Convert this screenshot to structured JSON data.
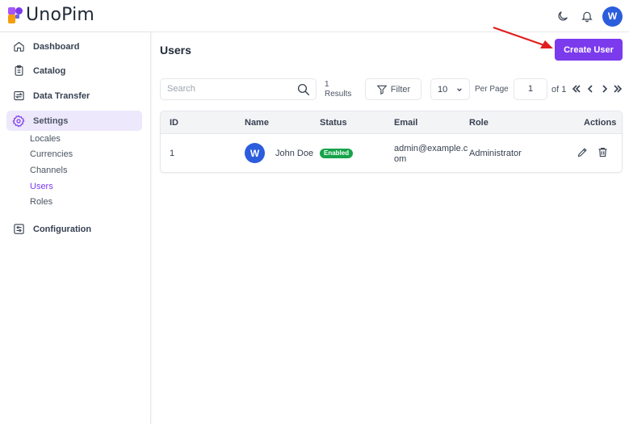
{
  "header": {
    "brand": "UnoPim",
    "avatar_letter": "W"
  },
  "sidebar": {
    "items": [
      {
        "label": "Dashboard"
      },
      {
        "label": "Catalog"
      },
      {
        "label": "Data Transfer"
      },
      {
        "label": "Settings"
      },
      {
        "label": "Configuration"
      }
    ],
    "settings_children": [
      {
        "label": "Locales"
      },
      {
        "label": "Currencies"
      },
      {
        "label": "Channels"
      },
      {
        "label": "Users"
      },
      {
        "label": "Roles"
      }
    ]
  },
  "main": {
    "title": "Users",
    "create_button": "Create User",
    "search_placeholder": "Search",
    "results_count": "1",
    "results_label": "Results",
    "filter_label": "Filter",
    "per_page_value": "10",
    "per_page_label": "Per Page",
    "current_page": "1",
    "of_label": "of 1",
    "table": {
      "columns": [
        "ID",
        "Name",
        "Status",
        "Email",
        "Role",
        "Actions"
      ],
      "rows": [
        {
          "id": "1",
          "name": "John Doe",
          "status": "Enabled",
          "email_line1": "admin@example.c",
          "email_line2": "om",
          "role": "Administrator",
          "avatar_letter": "W"
        }
      ]
    }
  },
  "colors": {
    "accent": "#7c3aed",
    "accent_light": "#ede8fb",
    "status_enabled": "#16a34a",
    "avatar_bg": "#2b5ddc",
    "annotation_arrow": "#e11d1d"
  }
}
